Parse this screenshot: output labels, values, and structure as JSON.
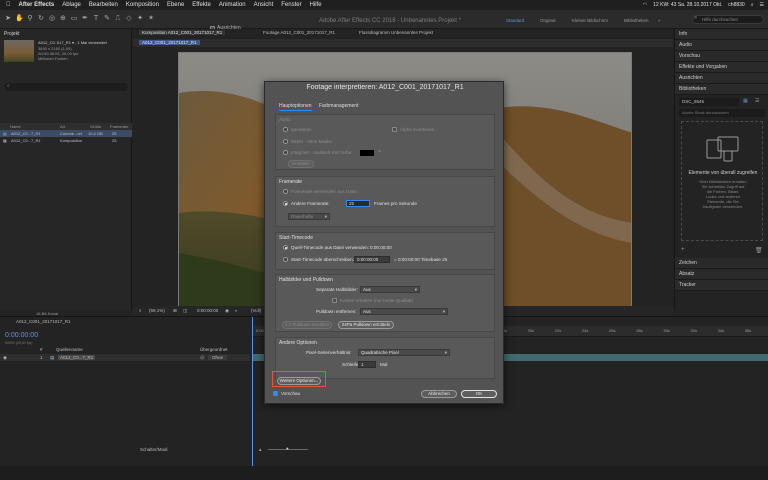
{
  "menubar": {
    "apple": "",
    "app_name": "After Effects",
    "items": [
      "Ablage",
      "Bearbeiten",
      "Komposition",
      "Ebene",
      "Effekte",
      "Animation",
      "Ansicht",
      "Fenster",
      "Hilfe"
    ],
    "status": "12 KW: 43 Sa. 28.10.2017 Okt.",
    "user": "ch8830"
  },
  "toolbar": {
    "align_label": "Ausrichten",
    "title": "Adobe After Effects CC 2018 - Unbenanntes Projekt *",
    "workspaces": [
      "Standard",
      "Original",
      "Kleiner Bildschirm",
      "Bibliotheken"
    ],
    "search_placeholder": "Hilfe durchsuchen"
  },
  "project": {
    "tab": "Projekt",
    "info_lines": [
      "A012_C0..017_R1 ▾ , 1 Mal verwendet",
      "3840 x 2160 (1,00)",
      "Δ0:00:36:05, 25,00 fps",
      "Millionen Farben"
    ],
    "columns": [
      "Name",
      "Art",
      "Größe",
      "Framerate"
    ],
    "rows": [
      {
        "name": "A012_C0...7_R1",
        "type": "Comme...ort",
        "size": "10,4 GB",
        "fps": "25",
        "selected": true
      },
      {
        "name": "A012_C0...7_R1",
        "type": "Komposition",
        "size": "",
        "fps": "25",
        "selected": false
      }
    ],
    "bpc": "16-Bit-Kanal"
  },
  "composition": {
    "tabs": [
      "Komposition A012_C001_20171017_R1",
      "Footage A012_C001_20171017_R1",
      "Flussdiagramm Unbenanntes Projekt"
    ],
    "subtab": "A012_C001_20171017_R1",
    "footer": {
      "zoom": "(59,1%)",
      "time": "0:00:00:00",
      "res": "(Voll)"
    }
  },
  "right_panel": {
    "sections_top": [
      "Info",
      "Audio",
      "Vorschau",
      "Effekte und Vorgaben",
      "Ausrichten",
      "Bibliotheken"
    ],
    "library_name": "DSC_8645",
    "library_search": "Adobe Stock durchsuchen",
    "empty_title": "Elemente von überall zugreifen",
    "empty_text": [
      "Über Bibliotheken erhalten",
      "Sie schnellen Zugriff auf",
      "die Farben, Bilder,",
      "Looks und anderen",
      "Elemente, die Sie",
      "häufigsten verwenden."
    ],
    "sections_bottom": [
      "Zeichen",
      "Absatz",
      "Tracker"
    ]
  },
  "timeline": {
    "tab": "A012_C001_20171017_R1",
    "timecode": "0:00:00:00",
    "fps_note": "00000 (25,00 fps)",
    "columns": [
      "#",
      "Quellenname",
      "Übergeordnet"
    ],
    "layer": {
      "index": "1",
      "name": "A012_C0...7_R1",
      "parent": "Ohne"
    },
    "ticks": [
      "0:00s",
      "02s",
      "04s",
      "06s",
      "08s",
      "10s",
      "12s",
      "14s",
      "16s",
      "18s",
      "20s",
      "22s",
      "24s",
      "26s",
      "28s",
      "30s",
      "32s",
      "34s",
      "36s"
    ],
    "toggle_label": "Schalter/Modi"
  },
  "dialog": {
    "title": "Footage interpretieren: A012_C001_20171017_R1",
    "tabs": [
      "Hauptoptionen",
      "Farbmanagement"
    ],
    "alpha": {
      "header": "Alpha",
      "ignore": "Ignorieren",
      "invert": "Alpha invertieren",
      "direct": "Direkt - ohne Maske",
      "premult": "Integriert - maskiert mit Farbe:",
      "guess": "Ermitteln"
    },
    "framerate": {
      "header": "Framerate",
      "from_file": "Framerate verwenden aus Datei:",
      "assume": "Andere Framerate:",
      "value": "25",
      "unit": "Frames pro Sekunde",
      "remap": "Dauerhafte"
    },
    "timecode": {
      "header": "Start-Timecode",
      "from_source": "Quell-Timecode aus Datei verwenden:",
      "source_value": "0:00:00:00",
      "override": "Start-Timecode überschreiben:",
      "override_value": "0:00:00:00",
      "override_suffix": "= 0:00:00:00  Timebase 25"
    },
    "fields": {
      "header": "Halbbilder und Pulldown",
      "separate_label": "Separate Halbbilder:",
      "separate_value": "Aus",
      "preserve": "Kanten erhalten (nur beste Qualität)",
      "pulldown_label": "Pulldown entfernen:",
      "pulldown_value": "Aus",
      "guess3": "3:2 Pulldown ermitteln",
      "guess24": "24Pa Pulldown ermitteln"
    },
    "other": {
      "header": "Andere Optionen",
      "par_label": "Pixel-Seitenverhältnis:",
      "par_value": "Quadratische Pixel",
      "loop_label": "Schleife:",
      "loop_value": "1",
      "loop_unit": "Mal"
    },
    "more_options": "Weitere Optionen...",
    "preview": "Vorschau",
    "cancel": "Abbrechen",
    "ok": "OK"
  }
}
